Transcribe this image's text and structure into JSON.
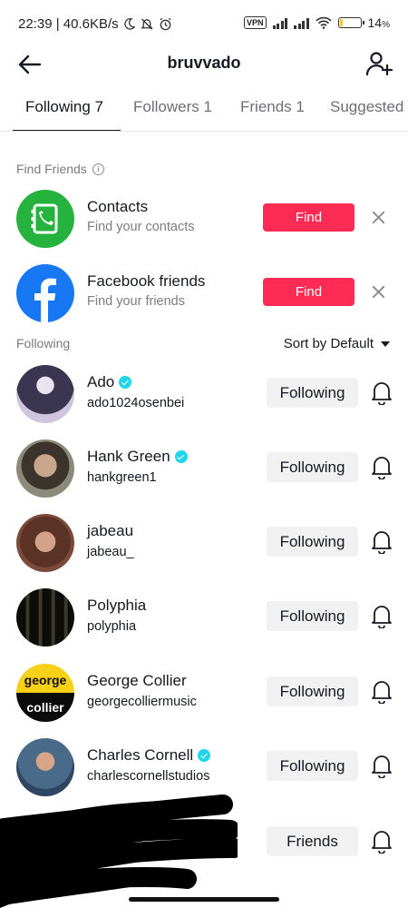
{
  "status_bar": {
    "time_speed": "22:39 | 40.6KB/s",
    "vpn": "VPN",
    "battery": "14",
    "battery_unit": "%",
    "battery_level": 0.14,
    "battery_color": "#f6c23a"
  },
  "header": {
    "title": "bruvvado"
  },
  "tabs": [
    {
      "label": "Following 7",
      "active": true
    },
    {
      "label": "Followers 1"
    },
    {
      "label": "Friends 1"
    },
    {
      "label": "Suggested"
    }
  ],
  "find_friends": {
    "label": "Find Friends",
    "info_glyph": "i",
    "items": [
      {
        "name": "Contacts",
        "sub": "Find your contacts",
        "button": "Find",
        "icon": "contacts-icon",
        "color": "#25b33e"
      },
      {
        "name": "Facebook friends",
        "sub": "Find your friends",
        "button": "Find",
        "icon": "facebook-icon",
        "color": "#1877f2"
      }
    ]
  },
  "following": {
    "label": "Following",
    "sort_label": "Sort by Default",
    "items": [
      {
        "name": "Ado",
        "handle": "ado1024osenbei",
        "verified": true,
        "button": "Following"
      },
      {
        "name": "Hank Green",
        "handle": "hankgreen1",
        "verified": true,
        "button": "Following"
      },
      {
        "name": "jabeau",
        "handle": "jabeau_",
        "verified": false,
        "button": "Following"
      },
      {
        "name": "Polyphia",
        "handle": "polyphia",
        "verified": false,
        "button": "Following"
      },
      {
        "name": "George Collier",
        "handle": "georgecolliermusic",
        "verified": false,
        "button": "Following",
        "avatar_text": [
          "george",
          "collier"
        ]
      },
      {
        "name": "Charles Cornell",
        "handle": "charlescornellstudios",
        "verified": true,
        "button": "Following"
      },
      {
        "name": "",
        "handle": "",
        "verified": false,
        "button": "Friends",
        "redacted": true
      }
    ]
  },
  "colors": {
    "accent": "#fe2c55",
    "verified": "#20d5ec",
    "button_bg": "#f1f1f2"
  }
}
